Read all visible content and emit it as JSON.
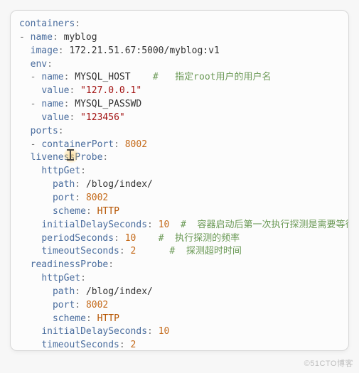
{
  "yaml": {
    "top_key": "containers",
    "item_name_key": "name",
    "item_name_val": "myblog",
    "image_key": "image",
    "image_val": "172.21.51.67:5000/myblog:v1",
    "env_key": "env",
    "env": [
      {
        "name_key": "name",
        "name_val": "MYSQL_HOST",
        "comment": "#   指定root用户的用户名",
        "value_key": "value",
        "value_val": "\"127.0.0.1\""
      },
      {
        "name_key": "name",
        "name_val": "MYSQL_PASSWD",
        "value_key": "value",
        "value_val": "\"123456\""
      }
    ],
    "ports_key": "ports",
    "containerPort_key": "containerPort",
    "containerPort_val": "8002",
    "liveness_key": "livenessProbe",
    "readiness_key": "readinessProbe",
    "httpGet_key": "httpGet",
    "path_key": "path",
    "path_val": "/blog/index/",
    "port_key": "port",
    "port_val": "8002",
    "scheme_key": "scheme",
    "scheme_val": "HTTP",
    "initialDelay_key": "initialDelaySeconds",
    "initialDelay_val": "10",
    "initialDelay_comment": "#  容器启动后第一次执行探测是需要等待多少秒",
    "period_key": "periodSeconds",
    "period_val": "10",
    "period_comment": "#  执行探测的频率",
    "timeout_key": "timeoutSeconds",
    "timeout_val": "2",
    "timeout_comment": "#  探测超时时间"
  },
  "watermark": "©51CTO博客"
}
